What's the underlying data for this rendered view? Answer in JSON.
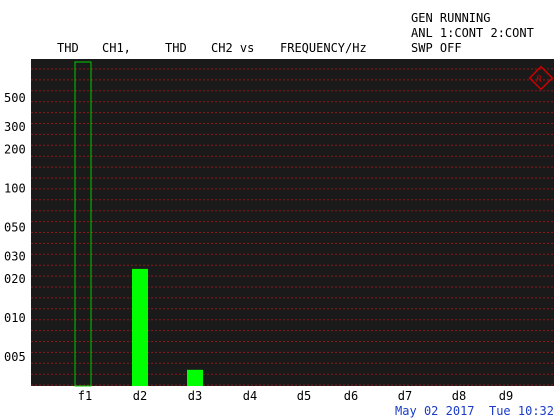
{
  "status": {
    "line1": "GEN RUNNING",
    "line2": "ANL 1:CONT 2:CONT",
    "line3": "SWP OFF"
  },
  "header": {
    "thd1": "THD",
    "ch1": "CH1,",
    "thd2": "THD",
    "ch2": "CH2 vs",
    "freq": "FREQUENCY/Hz"
  },
  "footer": {
    "datetime": "May 02 2017  Tue 10:32"
  },
  "colors": {
    "plot_background": "#1a1a1a",
    "grid": "#8b1a1a",
    "bar_fill": "#00ff00",
    "marker_outline": "#00cc00",
    "logo": "#cc0000"
  },
  "logo_icon": "rs-diamond-logo-icon",
  "chart_data": {
    "type": "bar",
    "categories": [
      "f1",
      "d2",
      "d3",
      "d4",
      "d5",
      "d6",
      "d7",
      "d8",
      "d9"
    ],
    "series": [
      {
        "values": [
          null,
          0.024,
          0.004,
          null,
          null,
          null,
          null,
          null,
          null
        ]
      }
    ],
    "fundamental_marker": "f1",
    "y_tick_labels": [
      "500",
      "300",
      "200",
      "100",
      "050",
      "030",
      "020",
      "010",
      "005"
    ],
    "y_tick_values": [
      0.5,
      0.3,
      0.2,
      0.1,
      0.05,
      0.03,
      0.02,
      0.01,
      0.005
    ],
    "yscale": "log",
    "ylim": [
      0.003,
      1
    ],
    "grid": true
  }
}
